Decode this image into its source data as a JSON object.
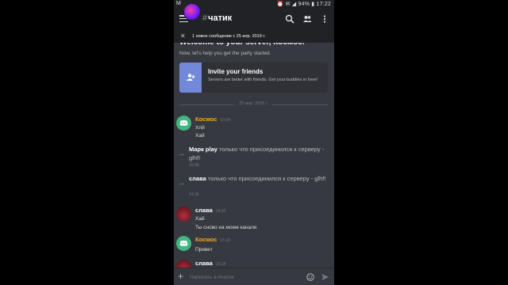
{
  "status_bar": {
    "left": "M",
    "right": "⏰ ✉ ◢ 94% ▮ 17:22"
  },
  "header": {
    "hash": "#",
    "channel": "чатик",
    "icons": [
      "search-icon",
      "members-icon",
      "more-vert-icon"
    ]
  },
  "banner": {
    "close": "✕",
    "text": "1 новое сообщение с 25 апр. 2019 г."
  },
  "welcome": {
    "title": "Welcome to your server, Космос!",
    "subtitle": "Now, let's help you get the party started."
  },
  "invite": {
    "title": "Invite your friends",
    "description": "Servers are better with friends. Get your buddies in here!"
  },
  "date_divider": "25 апр. 2019 г.",
  "messages": [
    {
      "author": "Космос",
      "time": "10:34",
      "lines": [
        "Хлй",
        "Хай"
      ],
      "avatar": "discord-icon",
      "color": "#faa61a"
    },
    {
      "join_user": "Марк play",
      "join_rest": " только что присоединился к серверу - glhf!",
      "time": "10:38"
    },
    {
      "join_user": "слава",
      "join_rest": " только что присоединился к серверу - glhf!",
      "time": "14:35"
    },
    {
      "author": "слава",
      "time": "14:35",
      "lines": [
        "Хай",
        "Ты сново на моем канале"
      ],
      "avatar": "user-photo"
    },
    {
      "author": "Космос",
      "time": "15:18",
      "lines": [
        "Привет"
      ],
      "avatar": "discord-icon",
      "color": "#faa61a"
    },
    {
      "author": "слава",
      "time": "15:18",
      "lines": [],
      "avatar": "user-photo"
    }
  ],
  "composer": {
    "plus": "+",
    "placeholder": "Написать в #чатик"
  },
  "colors": {
    "accent": "#7289da",
    "discord_green": "#43b581",
    "bg": "#36393f",
    "header": "#202225"
  }
}
